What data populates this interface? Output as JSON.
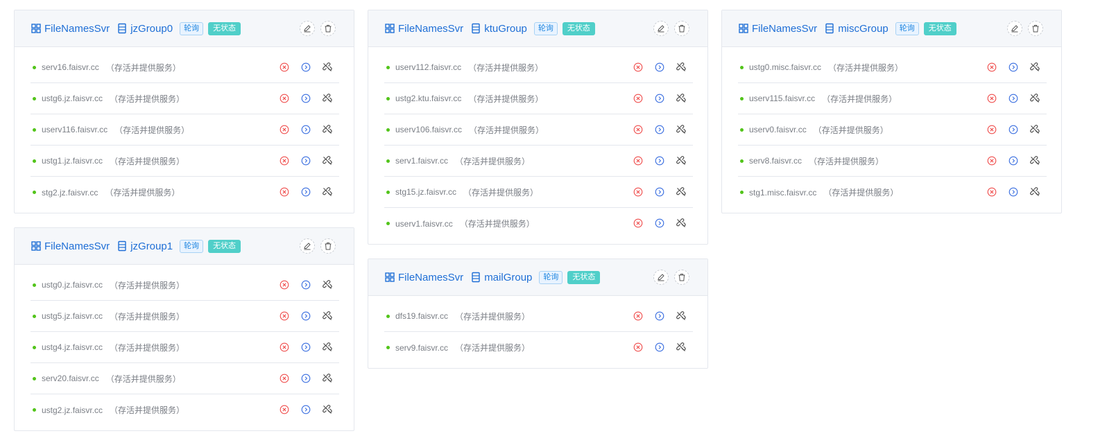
{
  "colors": {
    "accent": "#1f6fd6",
    "online_dot": "#52c41a",
    "stop": "#f0504f",
    "play": "#3b6fe0",
    "stateless_tag_bg": "#50cfc9"
  },
  "cards": [
    {
      "service": "FileNamesSvr",
      "group": "jzGroup0",
      "tag_poll": "轮询",
      "tag_state": "无状态",
      "rows": [
        {
          "host": "serv16.faisvr.cc",
          "status": "（存活并提供服务）"
        },
        {
          "host": "ustg6.jz.faisvr.cc",
          "status": "（存活并提供服务）"
        },
        {
          "host": "userv116.faisvr.cc",
          "status": "（存活并提供服务）"
        },
        {
          "host": "ustg1.jz.faisvr.cc",
          "status": "（存活并提供服务）"
        },
        {
          "host": "stg2.jz.faisvr.cc",
          "status": "（存活并提供服务）"
        }
      ]
    },
    {
      "service": "FileNamesSvr",
      "group": "jzGroup1",
      "tag_poll": "轮询",
      "tag_state": "无状态",
      "rows": [
        {
          "host": "ustg0.jz.faisvr.cc",
          "status": "（存活并提供服务）"
        },
        {
          "host": "ustg5.jz.faisvr.cc",
          "status": "（存活并提供服务）"
        },
        {
          "host": "ustg4.jz.faisvr.cc",
          "status": "（存活并提供服务）"
        },
        {
          "host": "serv20.faisvr.cc",
          "status": "（存活并提供服务）"
        },
        {
          "host": "ustg2.jz.faisvr.cc",
          "status": "（存活并提供服务）"
        }
      ]
    },
    {
      "service": "FileNamesSvr",
      "group": "ktuGroup",
      "tag_poll": "轮询",
      "tag_state": "无状态",
      "rows": [
        {
          "host": "userv112.faisvr.cc",
          "status": "（存活并提供服务）"
        },
        {
          "host": "ustg2.ktu.faisvr.cc",
          "status": "（存活并提供服务）"
        },
        {
          "host": "userv106.faisvr.cc",
          "status": "（存活并提供服务）"
        },
        {
          "host": "serv1.faisvr.cc",
          "status": "（存活并提供服务）"
        },
        {
          "host": "stg15.jz.faisvr.cc",
          "status": "（存活并提供服务）"
        },
        {
          "host": "userv1.faisvr.cc",
          "status": "（存活并提供服务）"
        }
      ]
    },
    {
      "service": "FileNamesSvr",
      "group": "mailGroup",
      "tag_poll": "轮询",
      "tag_state": "无状态",
      "rows": [
        {
          "host": "dfs19.faisvr.cc",
          "status": "（存活并提供服务）"
        },
        {
          "host": "serv9.faisvr.cc",
          "status": "（存活并提供服务）"
        }
      ]
    },
    {
      "service": "FileNamesSvr",
      "group": "miscGroup",
      "tag_poll": "轮询",
      "tag_state": "无状态",
      "rows": [
        {
          "host": "ustg0.misc.faisvr.cc",
          "status": "（存活并提供服务）"
        },
        {
          "host": "userv115.faisvr.cc",
          "status": "（存活并提供服务）"
        },
        {
          "host": "userv0.faisvr.cc",
          "status": "（存活并提供服务）"
        },
        {
          "host": "serv8.faisvr.cc",
          "status": "（存活并提供服务）"
        },
        {
          "host": "stg1.misc.faisvr.cc",
          "status": "（存活并提供服务）"
        }
      ]
    }
  ]
}
